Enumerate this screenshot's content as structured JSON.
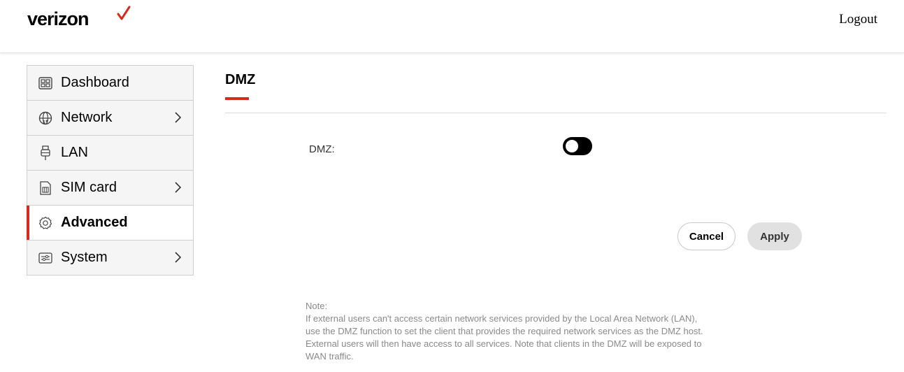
{
  "header": {
    "brand": "verizon",
    "brand_mark_color": "#d52b1e",
    "logout_label": "Logout"
  },
  "sidebar": {
    "items": [
      {
        "label": "Dashboard",
        "icon": "dashboard-icon",
        "has_chevron": false,
        "active": false
      },
      {
        "label": "Network",
        "icon": "network-globe-icon",
        "has_chevron": true,
        "active": false
      },
      {
        "label": "LAN",
        "icon": "lan-plug-icon",
        "has_chevron": false,
        "active": false
      },
      {
        "label": "SIM card",
        "icon": "sim-card-icon",
        "has_chevron": true,
        "active": false
      },
      {
        "label": "Advanced",
        "icon": "gear-icon",
        "has_chevron": false,
        "active": true
      },
      {
        "label": "System",
        "icon": "system-settings-icon",
        "has_chevron": true,
        "active": false
      }
    ],
    "active_accent": "#d52b1e"
  },
  "main": {
    "title": "DMZ",
    "dmz_label": "DMZ:",
    "dmz_enabled": false,
    "cancel_label": "Cancel",
    "apply_label": "Apply",
    "note_title": "Note:",
    "note_text": "If external users can't access certain network services provided by the Local Area Network (LAN), use the DMZ function to set the client that provides the required network services as the DMZ host. External users will then have access to all services. Note that clients in the DMZ will be exposed to WAN traffic."
  }
}
